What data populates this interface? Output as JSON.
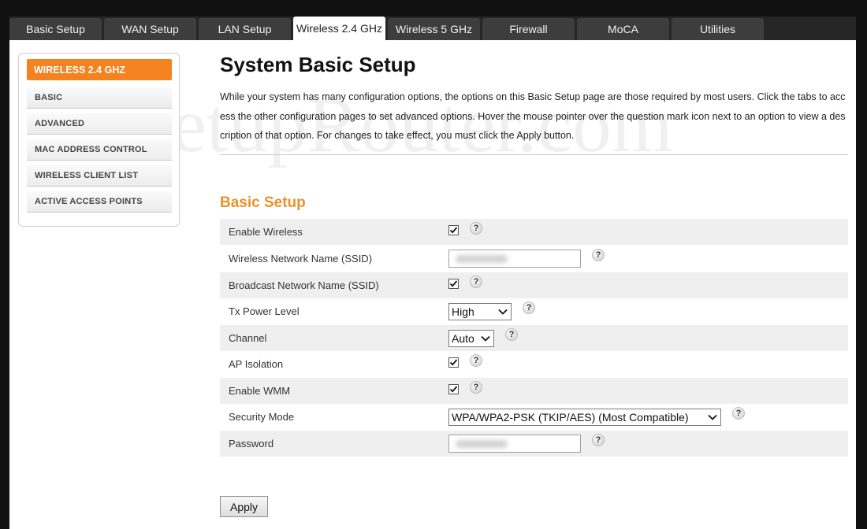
{
  "tabs": [
    {
      "label": "Basic Setup"
    },
    {
      "label": "WAN Setup"
    },
    {
      "label": "LAN Setup"
    },
    {
      "label": "Wireless 2.4 GHz"
    },
    {
      "label": "Wireless 5 GHz"
    },
    {
      "label": "Firewall"
    },
    {
      "label": "MoCA"
    },
    {
      "label": "Utilities"
    }
  ],
  "active_tab": "Wireless 2.4 GHz",
  "watermark": "SetupRouter.com",
  "sidebar": {
    "heading": "WIRELESS 2.4 GHZ",
    "items": [
      {
        "label": "BASIC"
      },
      {
        "label": "ADVANCED"
      },
      {
        "label": "MAC ADDRESS CONTROL"
      },
      {
        "label": "WIRELESS CLIENT LIST"
      },
      {
        "label": "ACTIVE ACCESS POINTS"
      }
    ]
  },
  "main": {
    "title": "System Basic Setup",
    "intro": "While your system has many configuration options, the options on this Basic Setup page are those required by most users. Click the tabs to access the other configuration pages to set advanced options. Hover the mouse pointer over the question mark icon next to an option to view a description of that option. For changes to take effect, you must click the Apply button.",
    "section_title": "Basic Setup",
    "help_glyph": "?",
    "fields": {
      "enable_wireless": {
        "label": "Enable Wireless",
        "checked": true
      },
      "ssid": {
        "label": "Wireless Network Name (SSID)"
      },
      "broadcast_ssid": {
        "label": "Broadcast Network Name (SSID)",
        "checked": true
      },
      "tx_power": {
        "label": "Tx Power Level",
        "value": "High"
      },
      "channel": {
        "label": "Channel",
        "value": "Auto"
      },
      "ap_isolation": {
        "label": "AP Isolation",
        "checked": true
      },
      "enable_wmm": {
        "label": "Enable WMM",
        "checked": true
      },
      "security_mode": {
        "label": "Security Mode",
        "value": "WPA/WPA2-PSK (TKIP/AES) (Most Compatible)"
      },
      "password": {
        "label": "Password"
      }
    },
    "apply_label": "Apply"
  },
  "colors": {
    "accent_orange": "#f58220",
    "section_title": "#e8932a",
    "tab_bg": "#3d3d3d",
    "row_shade": "#efefef"
  }
}
